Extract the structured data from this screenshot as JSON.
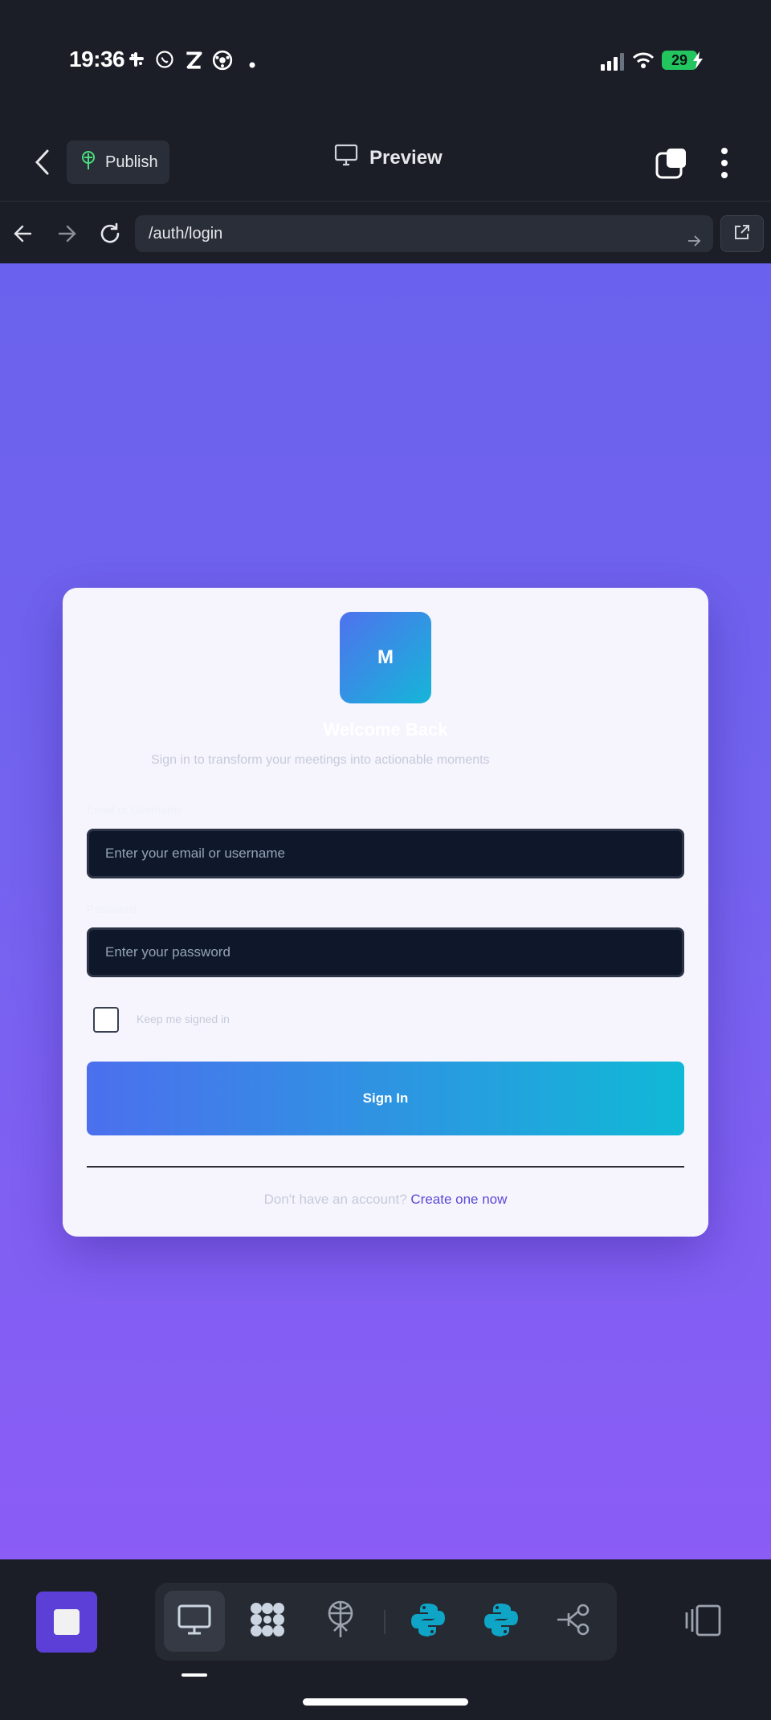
{
  "status_bar": {
    "time": "19:36",
    "battery": "29",
    "icons": [
      "slack-icon",
      "whatsapp-icon",
      "z-app-icon",
      "soccer-icon",
      "dot-icon",
      "signal-icon",
      "wifi-icon",
      "charging-icon"
    ]
  },
  "app_bar": {
    "publish_label": "Publish",
    "title": "Preview"
  },
  "browser": {
    "url": "/auth/login"
  },
  "login": {
    "logo_letter": "M",
    "welcome": "Welcome Back",
    "subtitle": "Sign in to transform your meetings into actionable moments",
    "email_label": "Email or Username",
    "email_placeholder": "Enter your email or username",
    "password_label": "Password",
    "password_placeholder": "Enter your password",
    "remember_label": "Keep me signed in",
    "signin_label": "Sign In",
    "no_account_text": "Don't have an account?",
    "create_link": "Create one now"
  },
  "colors": {
    "accent": "#5b3fd6",
    "gradient_start": "#4c6fee",
    "gradient_end": "#10b9d6",
    "page_bg_top": "#6a62ee",
    "page_bg_bottom": "#8b5cf6"
  },
  "bottom_toolbar": {
    "tools": [
      "desktop-icon",
      "network-icon",
      "deploy-icon",
      "python-icon",
      "python-icon",
      "share-icon"
    ],
    "active_tool": "desktop-icon"
  }
}
